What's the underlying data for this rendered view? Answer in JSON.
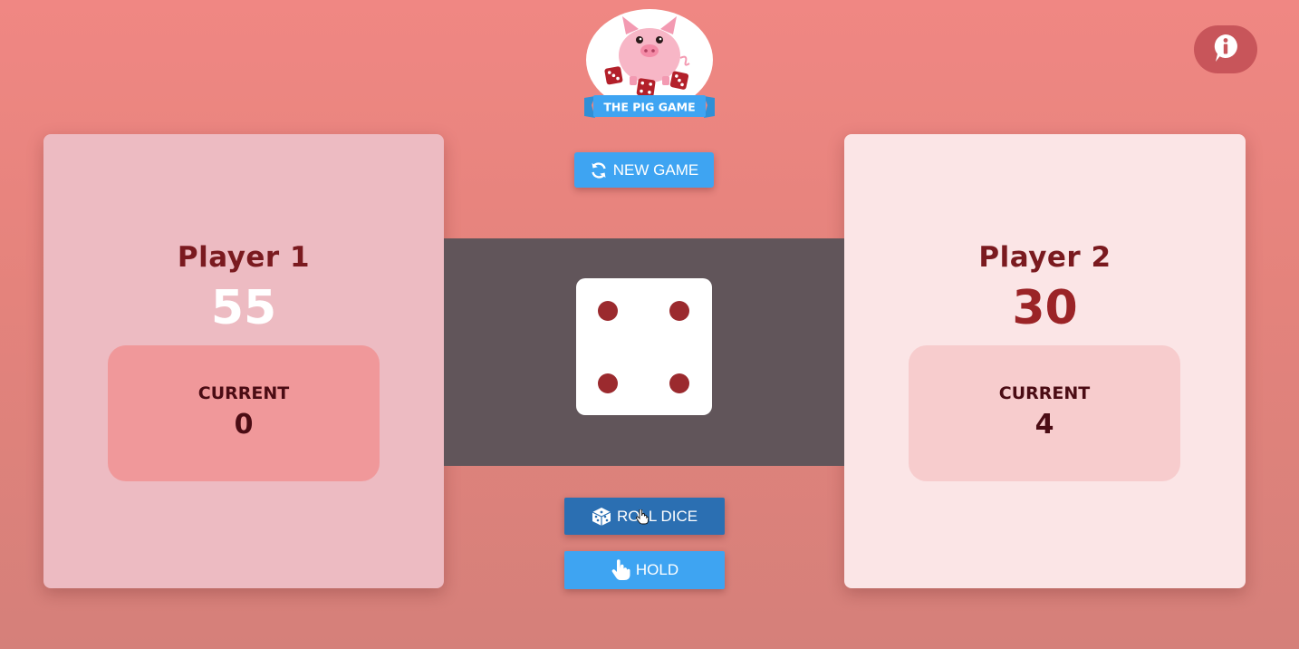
{
  "logo": {
    "text": "THE PIG GAME"
  },
  "info": {
    "icon": "info-icon"
  },
  "players": [
    {
      "name": "Player 1",
      "score": "55",
      "current_label": "CURRENT",
      "current": "0"
    },
    {
      "name": "Player 2",
      "score": "30",
      "current_label": "CURRENT",
      "current": "4"
    }
  ],
  "dice": {
    "value": 4
  },
  "buttons": {
    "new_game": "NEW GAME",
    "roll_dice": "ROLL DICE",
    "hold": "HOLD"
  },
  "colors": {
    "background": "#f08783",
    "player1_panel": "#edbbc2",
    "player2_panel": "#fbe5e6",
    "dice_band": "#61555a",
    "pip": "#9b2a2e",
    "button_blue": "#3ea4f2",
    "button_active": "#2b6fb2"
  }
}
